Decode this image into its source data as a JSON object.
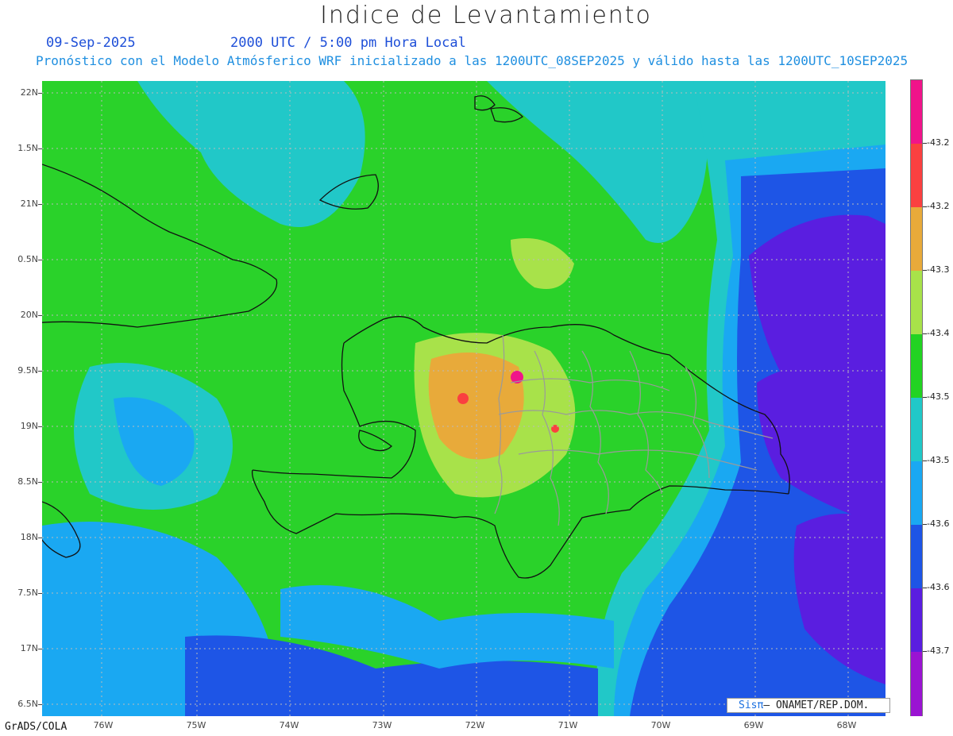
{
  "title": "Indice de Levantamiento",
  "date": "09-Sep-2025",
  "time": "2000 UTC / 5:00 pm Hora Local",
  "forecast": "Pronóstico con el Modelo Atmósferico WRF inicializado a las 1200UTC_08SEP2025 y válido hasta las  1200UTC_10SEP2025",
  "footer": "GrADS/COLA",
  "credit": {
    "sis": "Sisπ",
    "rest": " – ONAMET/REP.DOM."
  },
  "lat_labels": [
    "22N",
    "1.5N",
    "21N",
    "0.5N",
    "20N",
    "9.5N",
    "19N",
    "8.5N",
    "18N",
    "7.5N",
    "17N",
    "6.5N"
  ],
  "lon_labels": [
    "76W",
    "75W",
    "74W",
    "73W",
    "72W",
    "71W",
    "70W",
    "69W",
    "68W"
  ],
  "colorbar": {
    "labels": [
      "-43.2",
      "-43.2",
      "-43.3",
      "-43.4",
      "-43.5",
      "-43.5",
      "-43.6",
      "-43.6",
      "-43.7"
    ],
    "colors": [
      "#f0148a",
      "#fa4040",
      "#e8aa3a",
      "#a8e24a",
      "#22d322",
      "#21c8c8",
      "#1aa8f2",
      "#1e55e6",
      "#5a1ee0",
      "#9a14d2"
    ]
  },
  "map_colors": {
    "green": "#2ad22a",
    "lightgreen": "#a8e24a",
    "orange": "#e8aa3a",
    "red": "#fa4040",
    "magenta": "#f0148a",
    "cyan": "#21c8c8",
    "skyblue": "#1aa8f2",
    "blue": "#1e55e6",
    "violet": "#5a1ee0",
    "purple": "#9a14d2"
  }
}
